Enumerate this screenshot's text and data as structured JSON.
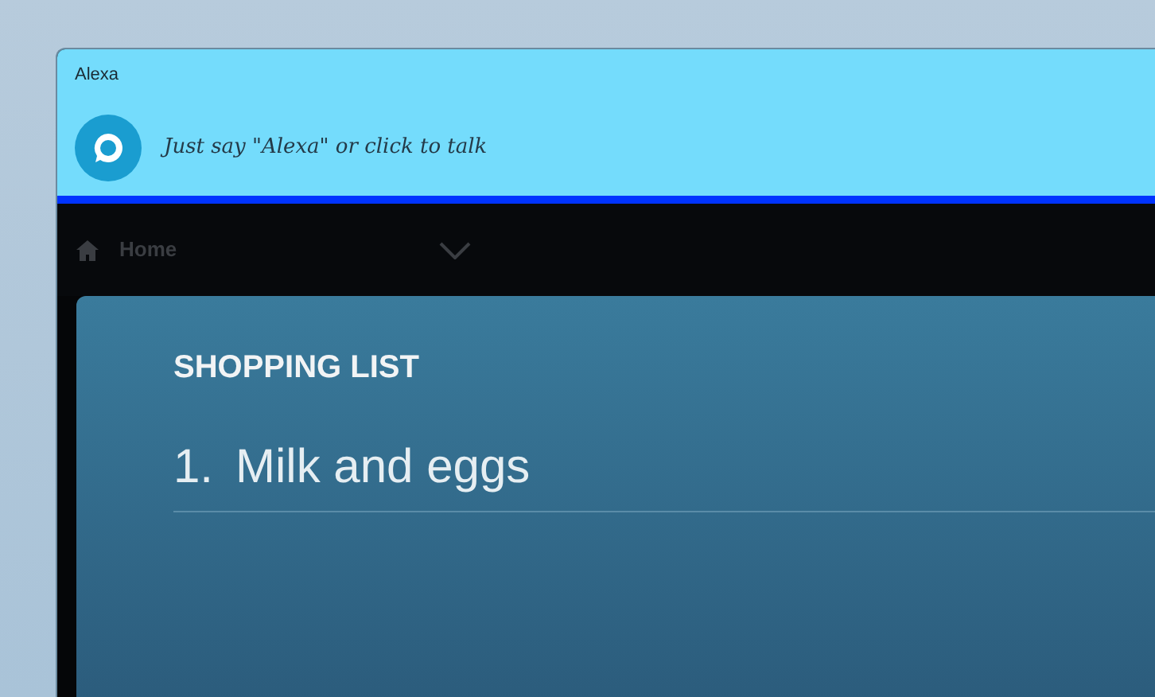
{
  "window": {
    "title": "Alexa"
  },
  "prompt": "Just say \"Alexa\" or click to talk",
  "nav": {
    "label": "Home"
  },
  "card": {
    "title": "SHOPPING LIST",
    "items": [
      {
        "number": "1.",
        "text": "Milk and eggs"
      }
    ]
  }
}
